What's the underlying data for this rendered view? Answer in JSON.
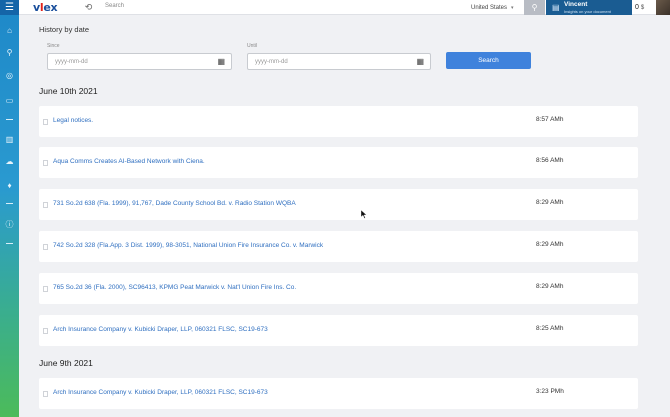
{
  "topbar": {
    "logo": "vlex",
    "search_placeholder": "Search",
    "country": "United States",
    "user_name": "Vincent",
    "user_subtitle": "Insights on your document",
    "count": "0",
    "currency": "$"
  },
  "history": {
    "title": "History by date",
    "since_label": "Since",
    "until_label": "Until",
    "since_placeholder": "yyyy-mm-dd",
    "until_placeholder": "yyyy-mm-dd",
    "search_label": "Search"
  },
  "groups": [
    {
      "date": "June 10th 2021",
      "items": [
        {
          "title": "Legal notices.",
          "time": "8:57 AMh"
        },
        {
          "title": "Aqua Comms Creates AI-Based Network with Ciena.",
          "time": "8:56 AMh"
        },
        {
          "title": "731 So.2d 638 (Fla. 1999), 91,767, Dade County School Bd. v. Radio Station WQBA",
          "time": "8:29 AMh"
        },
        {
          "title": "742 So.2d 328 (Fla.App. 3 Dist. 1999), 98-3051, National Union Fire Insurance Co. v. Marwick",
          "time": "8:29 AMh"
        },
        {
          "title": "765 So.2d 36 (Fla. 2000), SC96413, KPMG Peat Marwick v. Nat'l Union Fire Ins. Co.",
          "time": "8:29 AMh"
        },
        {
          "title": "Arch Insurance Company v. Kubicki Draper, LLP, 060321 FLSC, SC19-673",
          "time": "8:25 AMh"
        }
      ]
    },
    {
      "date": "June 9th 2021",
      "items": [
        {
          "title": "Arch Insurance Company v. Kubicki Draper, LLP, 060321 FLSC, SC19-673",
          "time": "3:23 PMh"
        }
      ]
    }
  ]
}
